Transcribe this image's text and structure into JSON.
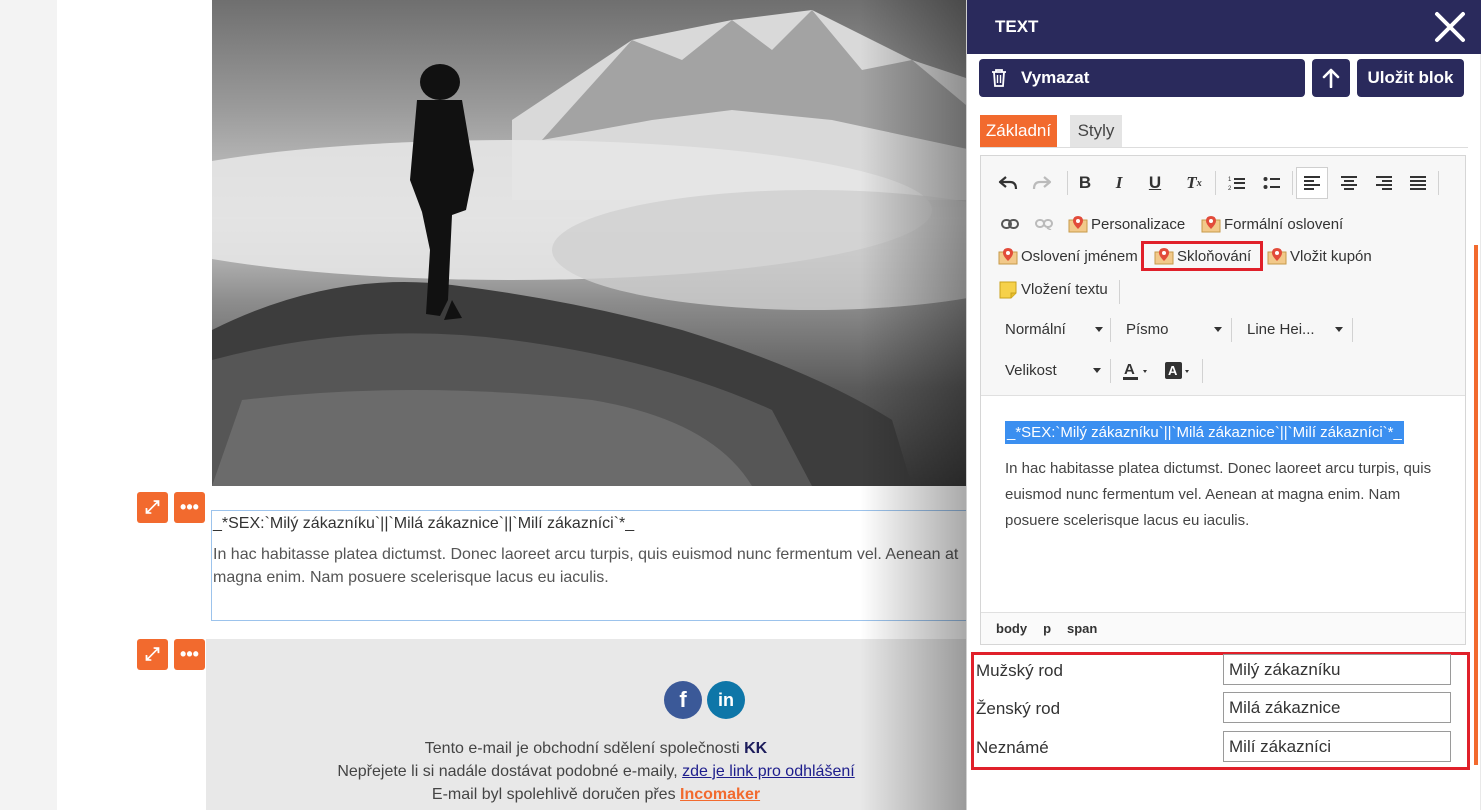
{
  "background": {
    "text_block": {
      "heading": "_*SEX:`Milý zákazníku`||`Milá zákaznice`||`Milí zákazníci`*_",
      "paragraph": "In hac habitasse platea dictumst. Donec laoreet arcu turpis, quis euismod nunc fermentum vel. Aenean at magna enim. Nam posuere scelerisque lacus eu iaculis."
    },
    "footer": {
      "line1_text": "Tento e-mail je obchodní sdělení společnosti",
      "line1_brand": "KK",
      "line2_text": "Nepřejete li si nadále dostávat podobné e-maily,",
      "line2_link": "zde je link pro odhlášení",
      "line3_text": "E-mail byl spolehlivě doručen přes",
      "line3_link": "Incomaker"
    },
    "social": {
      "facebook": "f",
      "linkedin": "in"
    },
    "colors": {
      "accent": "#f26a2e",
      "facebook": "#3b5998",
      "linkedin": "#0e76a8"
    }
  },
  "panel": {
    "title": "TEXT",
    "actions": {
      "delete": "Vymazat",
      "save": "Uložit blok"
    },
    "tabs": [
      "Základní",
      "Styly"
    ],
    "toolbar": {
      "plugins_row1": [
        "Personalizace",
        "Formální oslovení"
      ],
      "plugins_row2": [
        "Oslovení jménem",
        "Skloňování",
        "Vložit kupón"
      ],
      "plugins_row3": [
        "Vložení textu"
      ],
      "format": "Normální",
      "font": "Písmo",
      "line_height": "Line Hei...",
      "size": "Velikost"
    },
    "content": {
      "selected": "_*SEX:`Milý zákazníku`||`Milá zákaznice`||`Milí zákazníci`*_",
      "paragraph": "In hac habitasse platea dictumst. Donec laoreet arcu turpis, quis euismod nunc fermentum vel. Aenean at magna enim. Nam posuere scelerisque lacus eu iaculis."
    },
    "path": [
      "body",
      "p",
      "span"
    ],
    "gender_form": [
      {
        "label": "Mužský rod",
        "value": "Milý zákazníku"
      },
      {
        "label": "Ženský rod",
        "value": "Milá zákaznice"
      },
      {
        "label": "Neznámé",
        "value": "Milí zákazníci"
      }
    ],
    "colors": {
      "header": "#2a2a5c",
      "selection": "#3b8ff0",
      "highlight": "#e0202a"
    }
  }
}
